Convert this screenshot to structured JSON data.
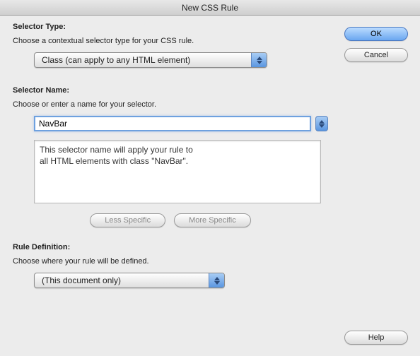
{
  "title": "New CSS Rule",
  "selectorType": {
    "label": "Selector Type:",
    "desc": "Choose a contextual selector type for your CSS rule.",
    "value": "Class (can apply to any HTML element)"
  },
  "selectorName": {
    "label": "Selector Name:",
    "desc": "Choose or enter a name for your selector.",
    "value": "NavBar",
    "explain1": "This selector name will apply your rule to",
    "explain2": "all HTML elements with class \"NavBar\"."
  },
  "specificity": {
    "less": "Less Specific",
    "more": "More Specific"
  },
  "ruleDef": {
    "label": "Rule Definition:",
    "desc": "Choose where your rule will be defined.",
    "value": "(This document only)"
  },
  "buttons": {
    "ok": "OK",
    "cancel": "Cancel",
    "help": "Help"
  }
}
